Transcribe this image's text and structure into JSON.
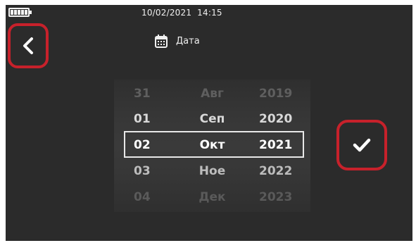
{
  "status_bar": {
    "date": "10/02/2021",
    "time": "14:15",
    "battery_icon": "battery-full-icon"
  },
  "header": {
    "title": "Дата",
    "icon": "calendar-icon"
  },
  "nav": {
    "back_icon": "chevron-left-icon",
    "confirm_icon": "checkmark-icon"
  },
  "picker": {
    "rows": [
      {
        "day": "31",
        "month": "Авг",
        "year": "2019"
      },
      {
        "day": "01",
        "month": "Сеп",
        "year": "2020"
      },
      {
        "day": "02",
        "month": "Окт",
        "year": "2021"
      },
      {
        "day": "03",
        "month": "Ное",
        "year": "2022"
      },
      {
        "day": "04",
        "month": "Дек",
        "year": "2023"
      }
    ],
    "selected_index": 2
  },
  "colors": {
    "background": "#2b2b2b",
    "highlight": "#c7212b",
    "text": "#ffffff"
  }
}
